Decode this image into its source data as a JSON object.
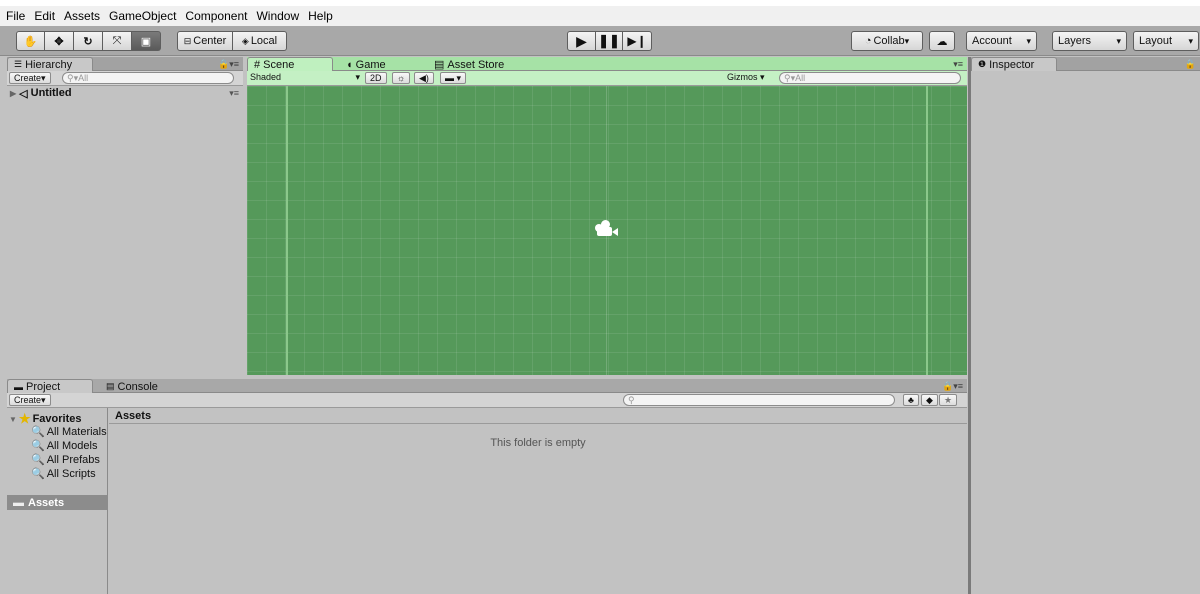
{
  "menu": [
    "File",
    "Edit",
    "Assets",
    "GameObject",
    "Component",
    "Window",
    "Help"
  ],
  "toolbar": {
    "pivot_label": "Center",
    "space_label": "Local",
    "collab_label": "Collab",
    "account_label": "Account",
    "layers_label": "Layers",
    "layout_label": "Layout"
  },
  "hierarchy": {
    "tab_label": "Hierarchy",
    "create_label": "Create",
    "search_placeholder": "All",
    "scene_name": "Untitled"
  },
  "scene": {
    "tabs": [
      "Scene",
      "Game",
      "Asset Store"
    ],
    "shading": "Shaded",
    "mode_2d": "2D",
    "gizmos_label": "Gizmos",
    "search_placeholder": "All",
    "background_color": "#55995a"
  },
  "inspector": {
    "tab_label": "Inspector"
  },
  "project": {
    "tabs": [
      "Project",
      "Console"
    ],
    "create_label": "Create",
    "favorites_label": "Favorites",
    "favorites": [
      "All Materials",
      "All Models",
      "All Prefabs",
      "All Scripts"
    ],
    "assets_label": "Assets",
    "breadcrumb": "Assets",
    "empty_message": "This folder is empty"
  }
}
